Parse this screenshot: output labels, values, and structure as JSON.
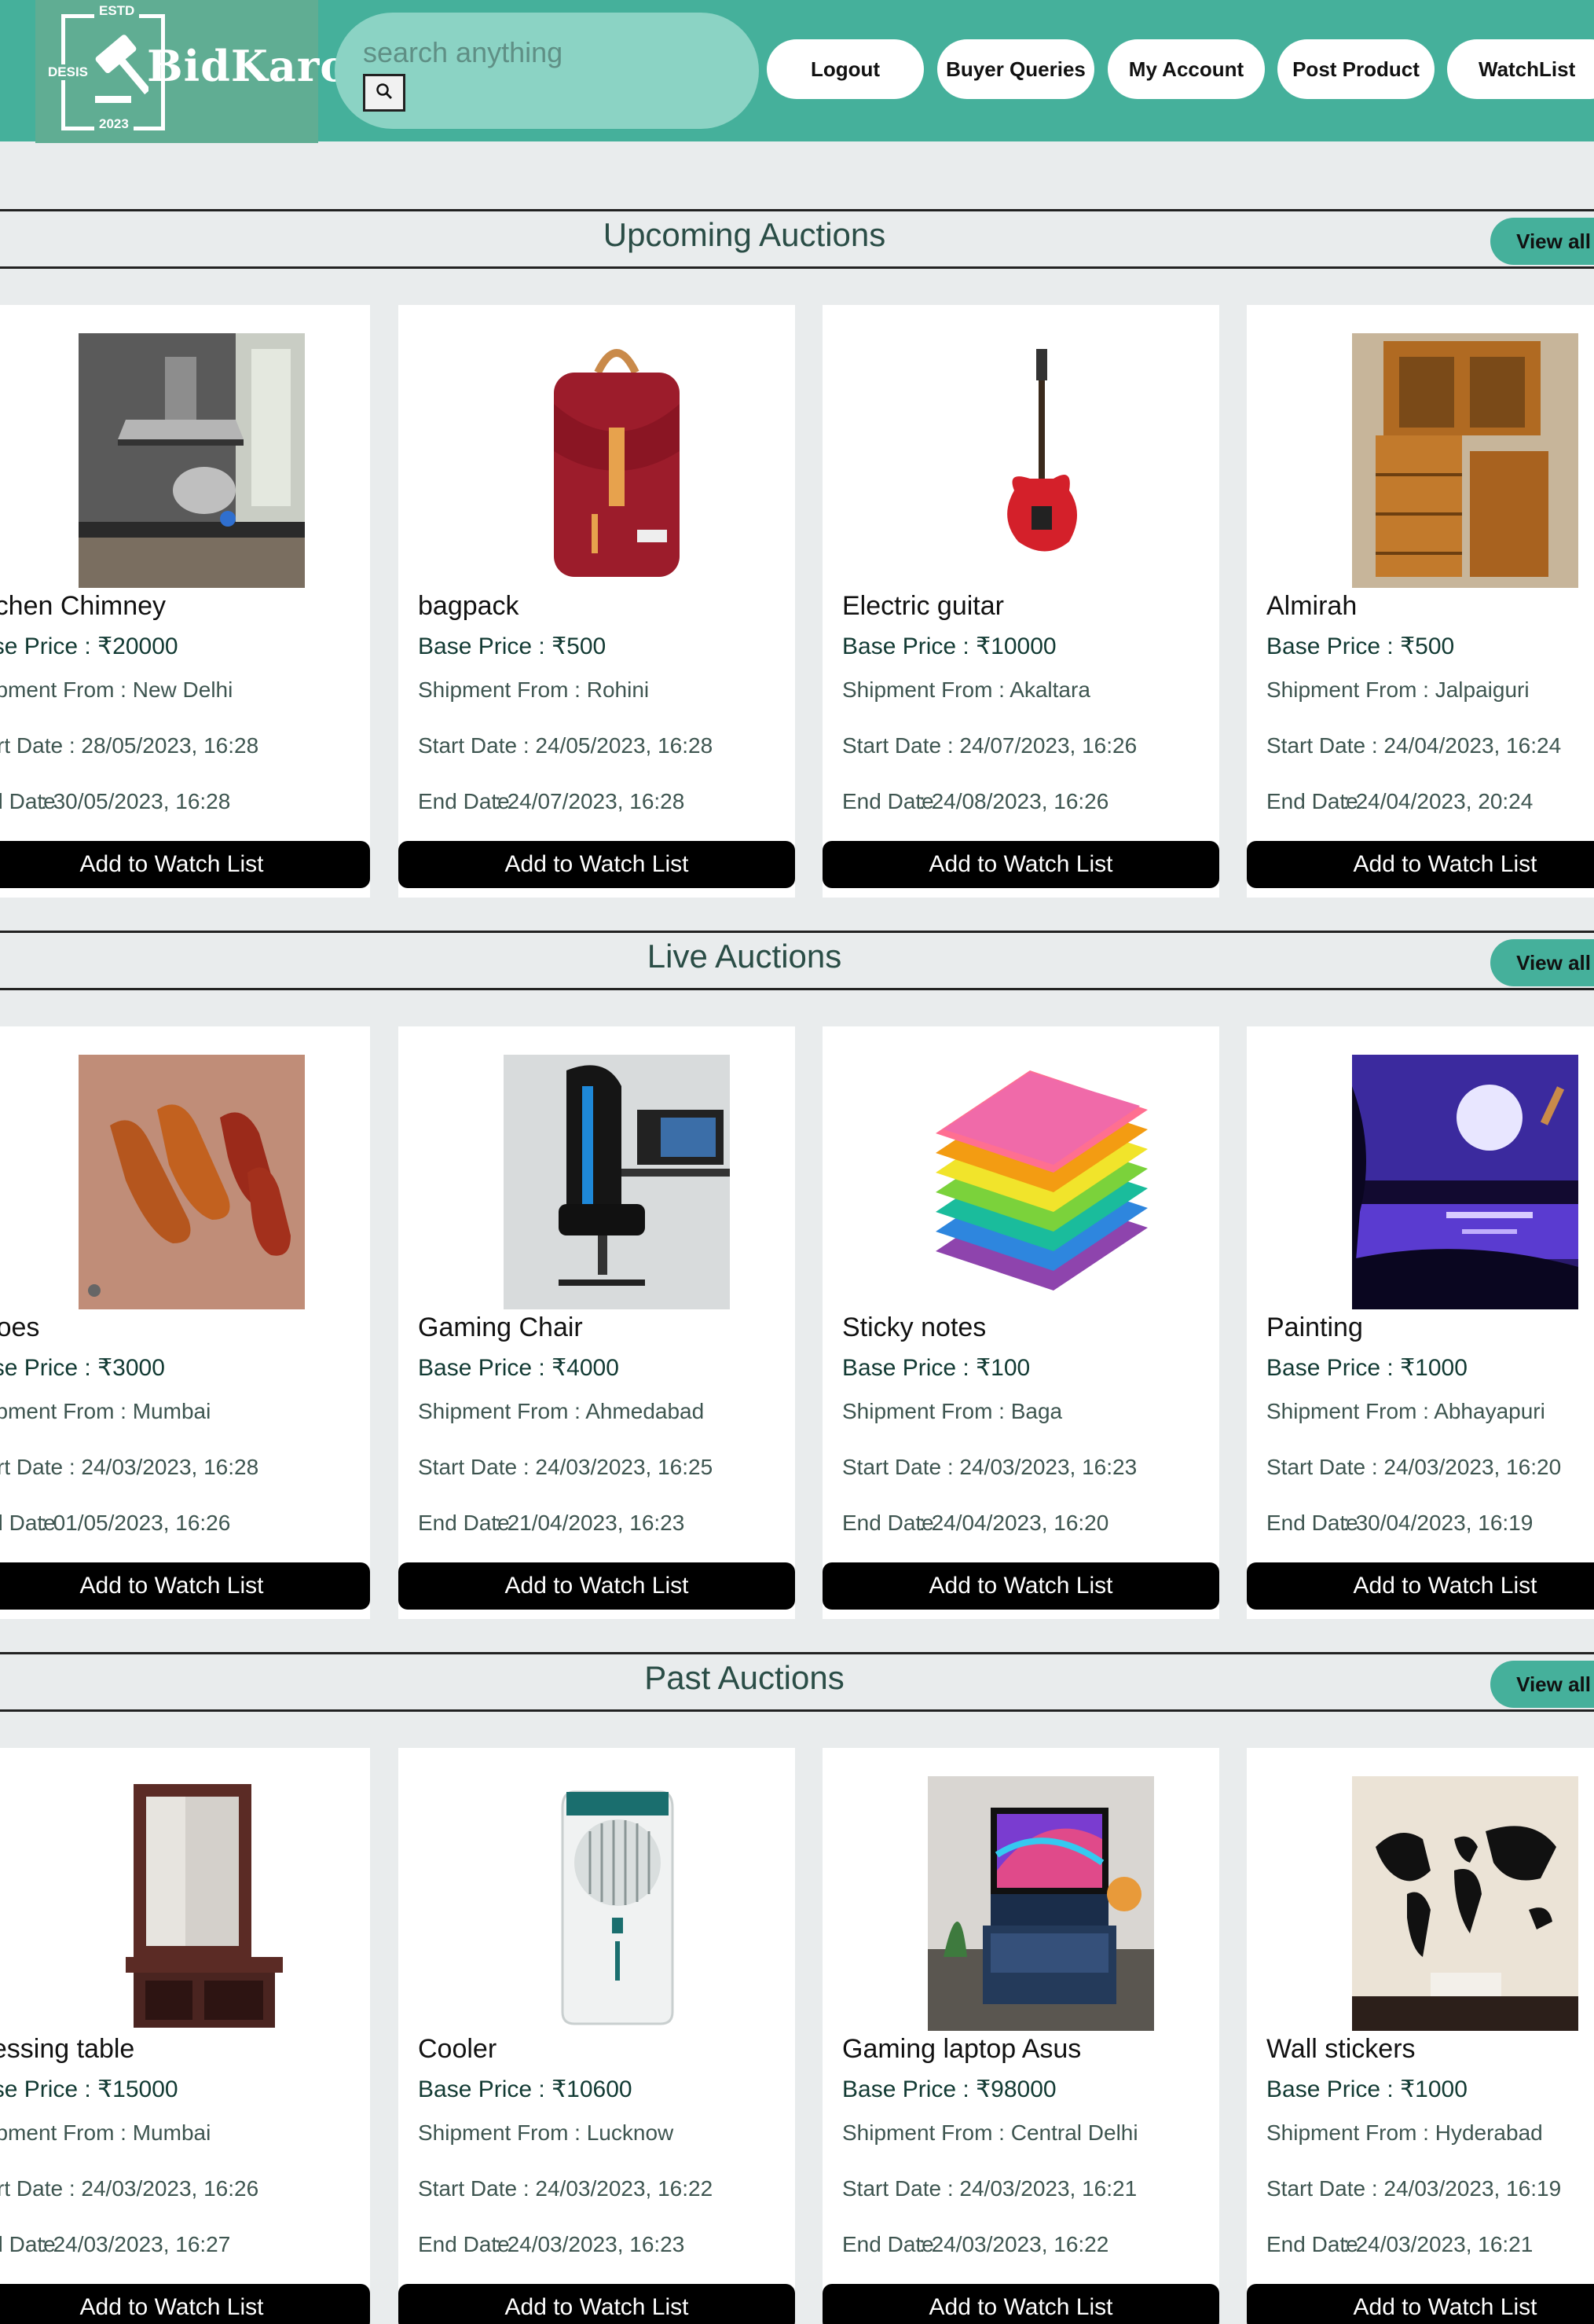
{
  "logo": {
    "estd": "ESTD",
    "desis": "DESIS",
    "name": "BidKaro",
    "year": "2023"
  },
  "search": {
    "placeholder": "search anything"
  },
  "nav": {
    "logout": "Logout",
    "buyer_queries": "Buyer Queries",
    "my_account": "My Account",
    "post_product": "Post Product",
    "watchlist": "WatchList"
  },
  "common": {
    "base_price_label": "Base Price : ",
    "shipment_label": "Shipment From : ",
    "start_label": "Start Date : ",
    "end_label": "End Date",
    "end_sep": ": ",
    "watch_button": "Add to Watch List",
    "view_all": "View all"
  },
  "colors": {
    "header": "#45b09b",
    "search": "#8bd3c4",
    "button": "#000000"
  },
  "sections": [
    {
      "title": "Upcoming Auctions",
      "items": [
        {
          "name": "Kitchen Chimney",
          "price": "₹20000",
          "ship": "New Delhi",
          "start": "28/05/2023, 16:28",
          "end": "30/05/2023, 16:28",
          "image": "kitchen-chimney"
        },
        {
          "name": "bagpack",
          "price": "₹500",
          "ship": "Rohini",
          "start": "24/05/2023, 16:28",
          "end": "24/07/2023, 16:28",
          "image": "backpack"
        },
        {
          "name": "Electric guitar",
          "price": "₹10000",
          "ship": "Akaltara",
          "start": "24/07/2023, 16:26",
          "end": "24/08/2023, 16:26",
          "image": "guitar"
        },
        {
          "name": "Almirah",
          "price": "₹500",
          "ship": "Jalpaiguri",
          "start": "24/04/2023, 16:24",
          "end": "24/04/2023, 20:24",
          "image": "almirah"
        }
      ]
    },
    {
      "title": "Live Auctions",
      "items": [
        {
          "name": "Shoes",
          "price": "₹3000",
          "ship": "Mumbai",
          "start": "24/03/2023, 16:28",
          "end": "01/05/2023, 16:26",
          "image": "shoes"
        },
        {
          "name": "Gaming Chair",
          "price": "₹4000",
          "ship": "Ahmedabad",
          "start": "24/03/2023, 16:25",
          "end": "21/04/2023, 16:23",
          "image": "gaming-chair"
        },
        {
          "name": "Sticky notes",
          "price": "₹100",
          "ship": "Baga",
          "start": "24/03/2023, 16:23",
          "end": "24/04/2023, 16:20",
          "image": "sticky-notes"
        },
        {
          "name": "Painting",
          "price": "₹1000",
          "ship": "Abhayapuri",
          "start": "24/03/2023, 16:20",
          "end": "30/04/2023, 16:19",
          "image": "painting"
        }
      ]
    },
    {
      "title": "Past Auctions",
      "items": [
        {
          "name": "Dressing table",
          "price": "₹15000",
          "ship": "Mumbai",
          "start": "24/03/2023, 16:26",
          "end": "24/03/2023, 16:27",
          "image": "dressing-table"
        },
        {
          "name": "Cooler",
          "price": "₹10600",
          "ship": "Lucknow",
          "start": "24/03/2023, 16:22",
          "end": "24/03/2023, 16:23",
          "image": "cooler"
        },
        {
          "name": "Gaming laptop Asus",
          "price": "₹98000",
          "ship": "Central Delhi",
          "start": "24/03/2023, 16:21",
          "end": "24/03/2023, 16:22",
          "image": "laptop"
        },
        {
          "name": "Wall stickers",
          "price": "₹1000",
          "ship": "Hyderabad",
          "start": "24/03/2023, 16:19",
          "end": "24/03/2023, 16:21",
          "image": "world-map"
        }
      ]
    }
  ]
}
